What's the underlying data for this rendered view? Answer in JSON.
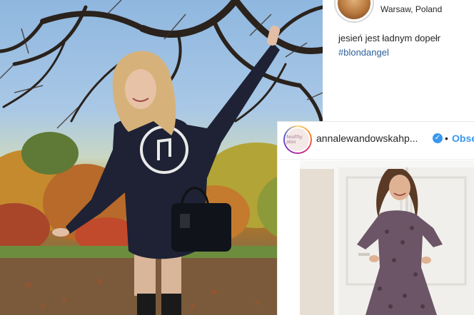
{
  "post1": {
    "location": "Warsaw, Poland",
    "caption": "jesień jest ładnym dopełr",
    "hashtag": "#blondangel"
  },
  "post2": {
    "username": "annalewandowskahp...",
    "avatar_text": "healthy plan",
    "separator": "•",
    "follow_label": "Obse"
  },
  "colors": {
    "link_blue": "#3897f0",
    "hashtag_blue": "#2b5e9a",
    "text_dark": "#262626"
  },
  "icons": {
    "verified": "verified-badge-icon",
    "music_note_print": "eighth-note-icon"
  }
}
